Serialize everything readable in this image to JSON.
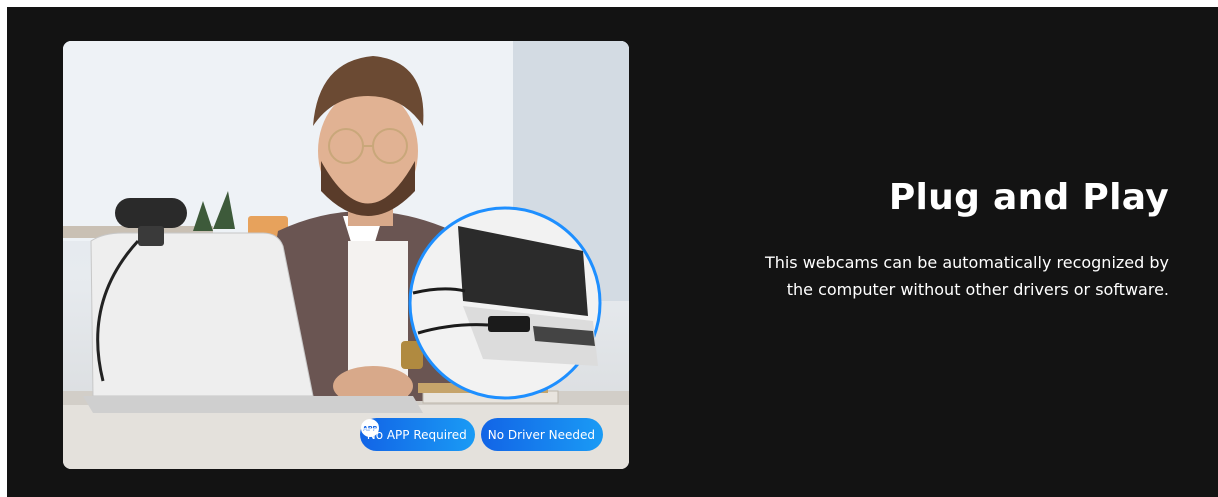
{
  "banner": {
    "title": "Plug and Play",
    "description_lines": [
      "This webcams can be automatically recognized by",
      "the computer without other drivers or software."
    ]
  },
  "badges": [
    {
      "label": "No APP Required",
      "icon": "app-icon"
    },
    {
      "label": "No Driver Needed",
      "icon": "drive-icon"
    }
  ],
  "icon_badge_text": "APP",
  "colors": {
    "background": "#131313",
    "text": "#ffffff",
    "badge_start": "#1264e6",
    "badge_end": "#1a9bf5",
    "inset_border": "#1e8fff"
  }
}
